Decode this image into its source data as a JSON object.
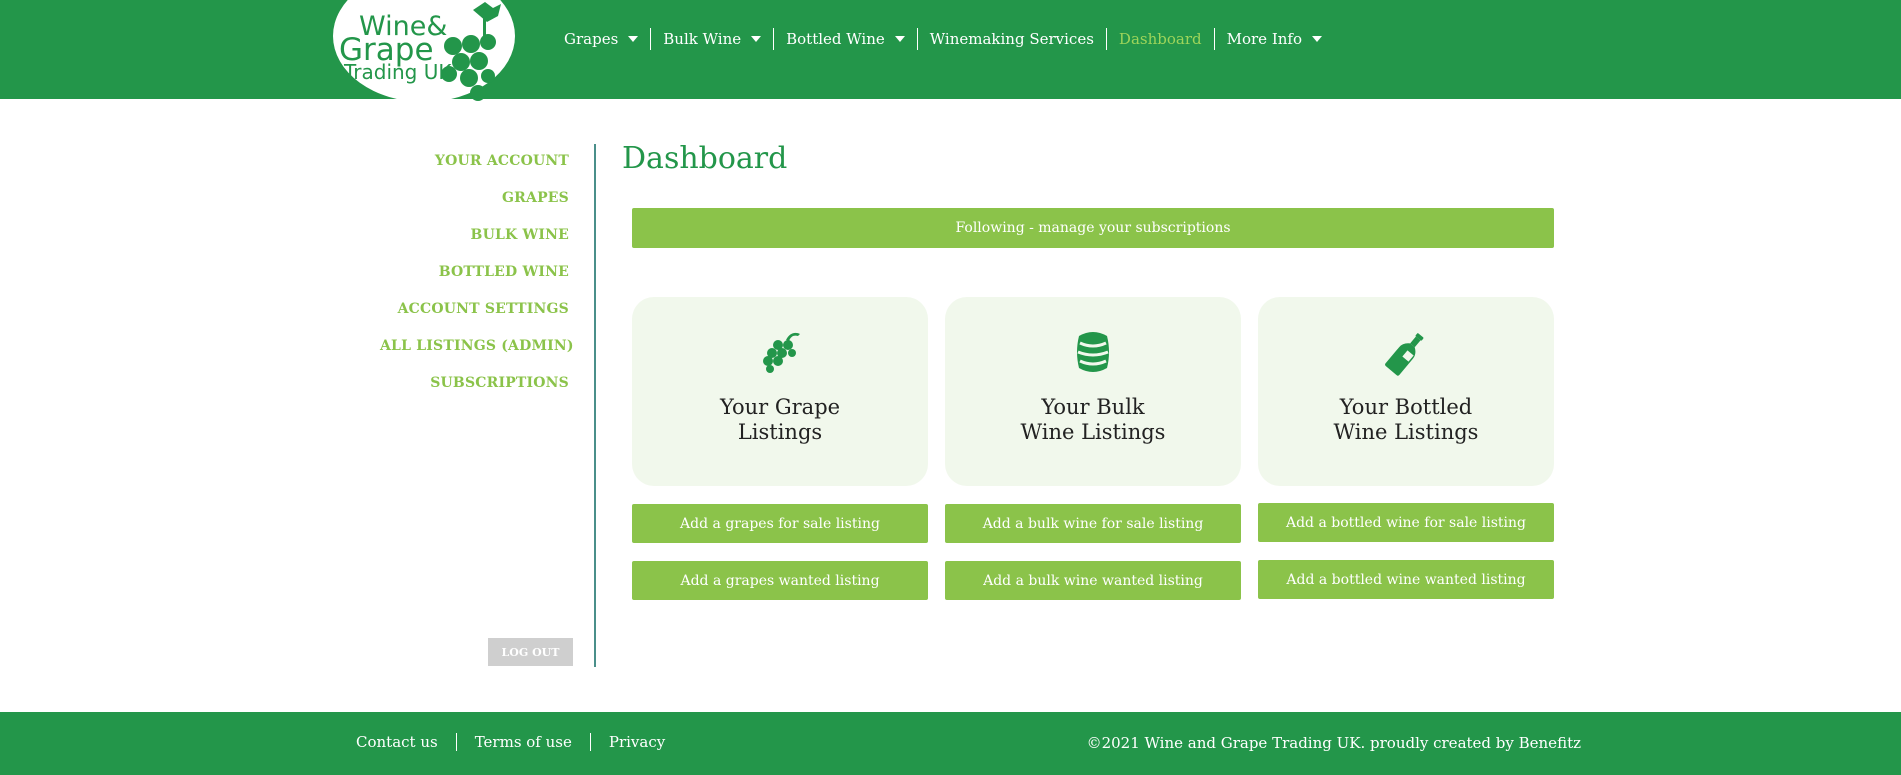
{
  "brand": {
    "logo_line1": "Wine&",
    "logo_line2": "Grape",
    "logo_line3": "Trading UK",
    "primary_color": "#23964a",
    "accent_color": "#8bc34a"
  },
  "nav": {
    "items": [
      {
        "label": "Grapes",
        "dropdown": true
      },
      {
        "label": "Bulk Wine",
        "dropdown": true
      },
      {
        "label": "Bottled Wine",
        "dropdown": true
      },
      {
        "label": "Winemaking Services",
        "dropdown": false
      },
      {
        "label": "Dashboard",
        "dropdown": false,
        "active": true
      },
      {
        "label": "More Info",
        "dropdown": true
      }
    ]
  },
  "sidebar": {
    "items": [
      {
        "label": "YOUR ACCOUNT"
      },
      {
        "label": "GRAPES"
      },
      {
        "label": "BULK WINE"
      },
      {
        "label": "BOTTLED WINE"
      },
      {
        "label": "ACCOUNT SETTINGS"
      },
      {
        "label": "ALL LISTINGS (ADMIN)"
      },
      {
        "label": "SUBSCRIPTIONS"
      }
    ],
    "logout_label": "LOG OUT"
  },
  "main": {
    "title": "Dashboard",
    "follow_label": "Following - manage your subscriptions",
    "cards": [
      {
        "title": "Your Grape\nListings",
        "icon": "grapes-icon"
      },
      {
        "title": "Your Bulk\nWine Listings",
        "icon": "barrel-icon"
      },
      {
        "title": "Your Bottled\nWine Listings",
        "icon": "bottle-icon"
      }
    ],
    "actions": [
      {
        "for_sale": "Add a grapes for sale listing",
        "wanted": "Add a grapes wanted listing"
      },
      {
        "for_sale": "Add a bulk wine for sale listing",
        "wanted": "Add a bulk wine wanted listing"
      },
      {
        "for_sale": "Add a bottled wine for sale listing",
        "wanted": "Add a bottled wine wanted listing"
      }
    ]
  },
  "footer": {
    "links": [
      {
        "label": "Contact us"
      },
      {
        "label": "Terms of use"
      },
      {
        "label": "Privacy"
      }
    ],
    "copyright": "©2021 Wine and Grape Trading UK. proudly created by Benefitz"
  }
}
